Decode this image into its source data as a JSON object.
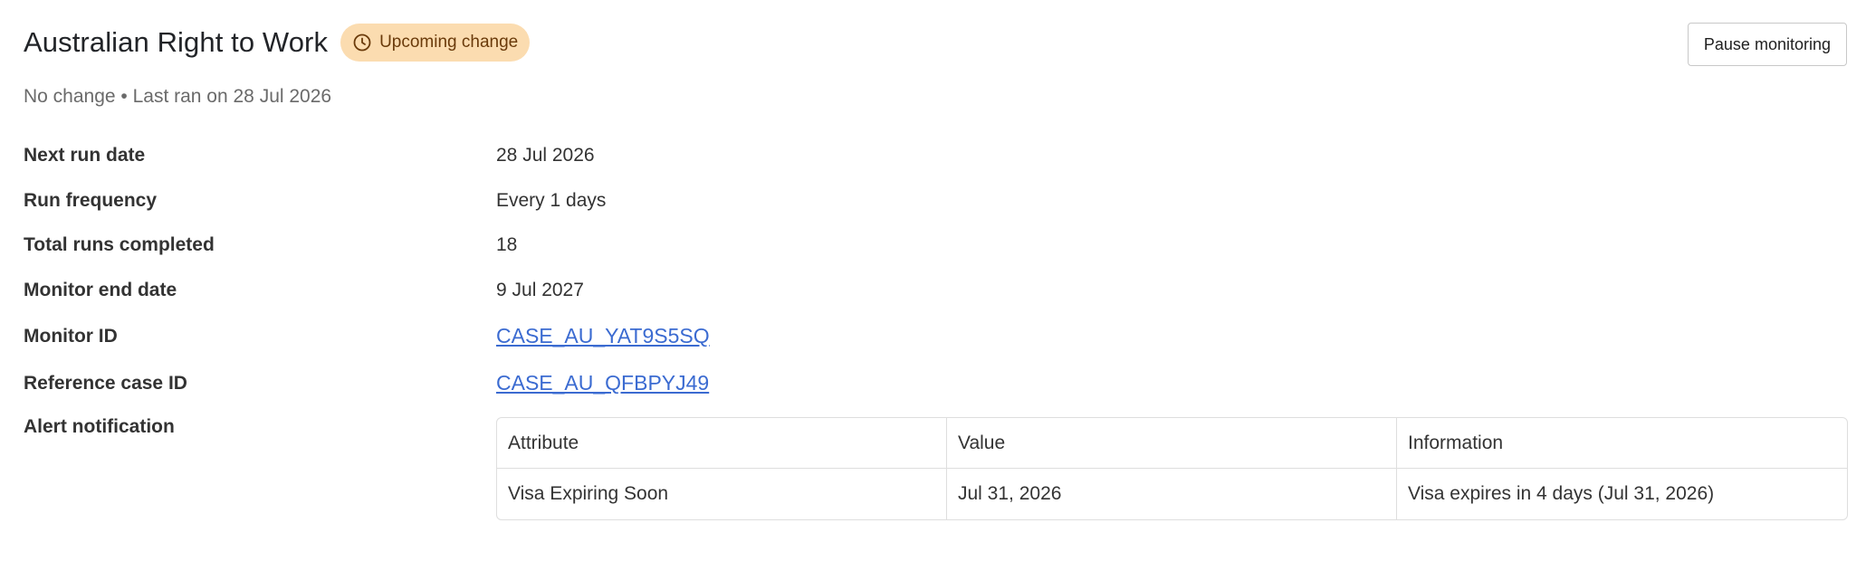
{
  "header": {
    "title": "Australian Right to Work",
    "badge_label": "Upcoming change",
    "badge_icon": "clock-icon",
    "pause_label": "Pause monitoring"
  },
  "subtitle": "No change • Last ran on 28 Jul 2026",
  "details": [
    {
      "label": "Next run date",
      "value": "28 Jul 2026"
    },
    {
      "label": "Run frequency",
      "value": "Every 1 days"
    },
    {
      "label": "Total runs completed",
      "value": "18"
    },
    {
      "label": "Monitor end date",
      "value": "9 Jul 2027"
    },
    {
      "label": "Monitor ID",
      "value": "CASE_AU_YAT9S5SQ"
    },
    {
      "label": "Reference case ID",
      "value": "CASE_AU_QFBPYJ49"
    },
    {
      "label": "Alert notification",
      "value": ""
    }
  ],
  "alert_table": {
    "columns": [
      "Attribute",
      "Value",
      "Information"
    ],
    "rows": [
      [
        "Visa Expiring Soon",
        "Jul 31, 2026",
        "Visa expires in 4 days (Jul 31, 2026)"
      ]
    ]
  },
  "colors": {
    "badge_bg": "#fbdcb0",
    "badge_text": "#6a3a0a",
    "link": "#3b6bd1"
  }
}
